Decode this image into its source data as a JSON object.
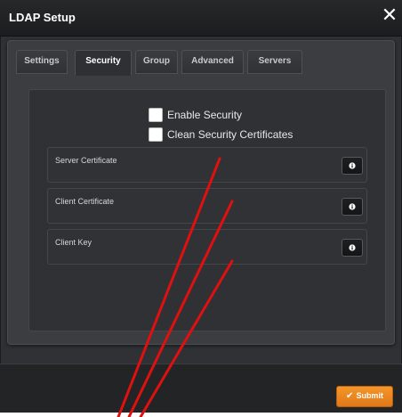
{
  "window": {
    "title": "LDAP Setup",
    "close_icon": "close-icon"
  },
  "tabs": [
    {
      "label": "Settings",
      "active": false
    },
    {
      "label": "Security",
      "active": true
    },
    {
      "label": "Group",
      "active": false
    },
    {
      "label": "Advanced",
      "active": false
    },
    {
      "label": "Servers",
      "active": false
    }
  ],
  "security": {
    "enable_security": {
      "label": "Enable Security",
      "checked": false
    },
    "clean_certificates": {
      "label": "Clean Security Certificates",
      "checked": false
    },
    "fields": [
      {
        "label": "Server Certificate",
        "button_icon": "info-icon"
      },
      {
        "label": "Client Certificate",
        "button_icon": "info-icon"
      },
      {
        "label": "Client Key",
        "button_icon": "info-icon"
      }
    ]
  },
  "footer": {
    "submit_label": "Submit",
    "submit_icon": "checkmark-icon"
  },
  "colors": {
    "accent": "#f08a24",
    "annotation": "#e01010"
  }
}
